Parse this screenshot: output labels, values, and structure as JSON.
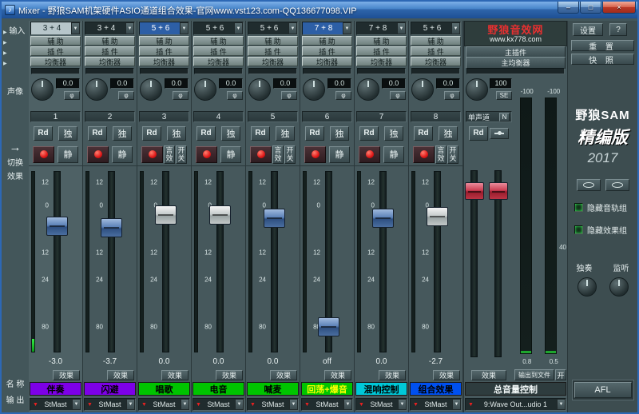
{
  "window": {
    "title": "Mixer - 野狼SAM机架硬件ASIO通道组合效果-官网www.vst123.com-QQ136677098.VIP",
    "controls": {
      "minimize": "–",
      "maximize": "□",
      "close": "×"
    }
  },
  "sidebar": {
    "input_label": "输入",
    "pan_label": "声像",
    "switch_label_1": "切换",
    "switch_label_2": "效果",
    "arrow": "→",
    "name_label": "名 称",
    "output_label": "输 出"
  },
  "rows": {
    "aux": "辅 助",
    "plugin": "插 件",
    "eq": "均衡器",
    "effect": "效果",
    "phase": "φ",
    "rd": "Rd",
    "solo": "独"
  },
  "fader_scale": [
    "12",
    "0",
    "12",
    "24",
    "80"
  ],
  "channels": [
    {
      "num": "1",
      "input": "3 + 4",
      "pan": "0.0",
      "db": "-3.0",
      "name": "伴奏",
      "output": "StMast",
      "mute_buttons": [
        "静"
      ],
      "name_bg": "#7d00e8",
      "name_fg": "#000000",
      "cap": "blue",
      "pos": 28,
      "meter": 16,
      "input_style": "light-dd",
      "active": true
    },
    {
      "num": "2",
      "input": "3 + 4",
      "pan": "0.0",
      "db": "-3.7",
      "name": "闪避",
      "output": "StMast",
      "mute_buttons": [
        "静"
      ],
      "name_bg": "#7d00e8",
      "name_fg": "#000000",
      "cap": "blue",
      "pos": 29,
      "meter": 0
    },
    {
      "num": "3",
      "input": "5 + 6",
      "pan": "0.0",
      "db": "0.0",
      "name": "唱歌",
      "output": "StMast",
      "mute_buttons": [
        "言效",
        "开关"
      ],
      "name_bg": "#00c400",
      "name_fg": "#000000",
      "cap": "white",
      "pos": 21,
      "meter": 0,
      "input_style": "selected"
    },
    {
      "num": "4",
      "input": "5 + 6",
      "pan": "0.0",
      "db": "0.0",
      "name": "电音",
      "output": "StMast",
      "mute_buttons": [
        "静"
      ],
      "name_bg": "#00c400",
      "name_fg": "#000000",
      "cap": "white",
      "pos": 21,
      "meter": 0
    },
    {
      "num": "5",
      "input": "5 + 6",
      "pan": "0.0",
      "db": "0.0",
      "name": "喊麦",
      "output": "StMast",
      "mute_buttons": [
        "言效",
        "开关"
      ],
      "name_bg": "#00c400",
      "name_fg": "#000000",
      "cap": "blue",
      "pos": 23,
      "meter": 0
    },
    {
      "num": "6",
      "input": "7 + 8",
      "pan": "0.0",
      "db": "off",
      "name": "回荡+爆音",
      "output": "StMast",
      "mute_buttons": [
        "静"
      ],
      "name_bg": "#00c400",
      "name_fg": "#ffff00",
      "cap": "blue",
      "pos": 90,
      "meter": 0,
      "input_style": "selected"
    },
    {
      "num": "7",
      "input": "7 + 8",
      "pan": "0.0",
      "db": "0.0",
      "name": "混响控制",
      "output": "StMast",
      "mute_buttons": [
        "静"
      ],
      "name_bg": "#00c8d8",
      "name_fg": "#000000",
      "cap": "blue",
      "pos": 23,
      "meter": 0
    },
    {
      "num": "8",
      "input": "5 + 6",
      "pan": "0.0",
      "db": "-2.7",
      "name": "组合效果",
      "output": "StMast",
      "mute_buttons": [
        "言效",
        "开关"
      ],
      "name_bg": "#0050f0",
      "name_fg": "#000000",
      "cap": "white",
      "pos": 22,
      "meter": 0
    }
  ],
  "master": {
    "logo_title": "野狼音效网",
    "logo_url": "www.kx778.com",
    "master_plugin": "主插件",
    "master_eq": "主均衡器",
    "pan_value": "100",
    "se": "SE",
    "mono": "单声道",
    "n": "N",
    "rd": "Rd",
    "meter_top": [
      "-100",
      "-100"
    ],
    "meter_scale": "40",
    "meter_bottom": [
      "0.8",
      "0.5"
    ],
    "effect": "效果",
    "out_file": "输出到文件",
    "on": "开",
    "name": "总音量控制",
    "output": "9:Wave Out...udio 1"
  },
  "panel": {
    "settings": "设置",
    "help": "?",
    "reset": "重 置",
    "snapshot": "快 照",
    "brand_1": "野狼SAM",
    "brand_2": "精编版",
    "brand_3": "2017",
    "hide_tracks": "隐藏音轨组",
    "hide_fx": "隐藏效果组",
    "solo": "独奏",
    "monitor": "监听",
    "afl": "AFL"
  }
}
